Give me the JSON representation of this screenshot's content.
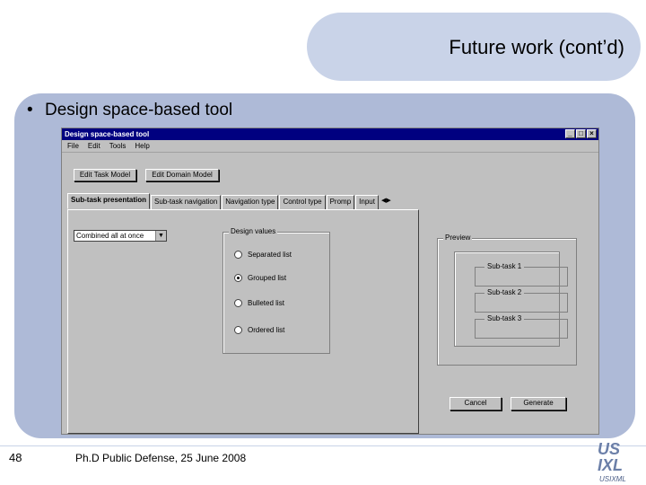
{
  "slide": {
    "title": "Future work (cont’d)",
    "bullet": "Design space-based tool",
    "page_number": "48",
    "footer": "Ph.D Public Defense, 25 June 2008",
    "logo_text": "USIXML"
  },
  "window": {
    "title": "Design space-based tool",
    "menu": [
      "File",
      "Edit",
      "Tools",
      "Help"
    ],
    "buttons": {
      "edit_task_model": "Edit Task Model",
      "edit_domain_model": "Edit Domain Model",
      "cancel": "Cancel",
      "generate": "Generate"
    },
    "tabs": [
      "Sub-task presentation",
      "Sub-task navigation",
      "Navigation type",
      "Control type",
      "Promp",
      "Input"
    ],
    "active_tab": "Sub-task presentation",
    "combo_value": "Combined all at once",
    "design_values": {
      "label": "Design values",
      "options": [
        "Separated list",
        "Grouped list",
        "Bulleted list",
        "Ordered list"
      ],
      "selected": "Grouped list"
    },
    "preview": {
      "label": "Preview",
      "subtasks": [
        "Sub-task 1",
        "Sub-task 2",
        "Sub-task 3"
      ]
    }
  },
  "colors": {
    "title_bar": "#000080",
    "panel_blue": "#aebad7",
    "title_box": "#c9d3e8",
    "window_gray": "#c0c0c0"
  }
}
